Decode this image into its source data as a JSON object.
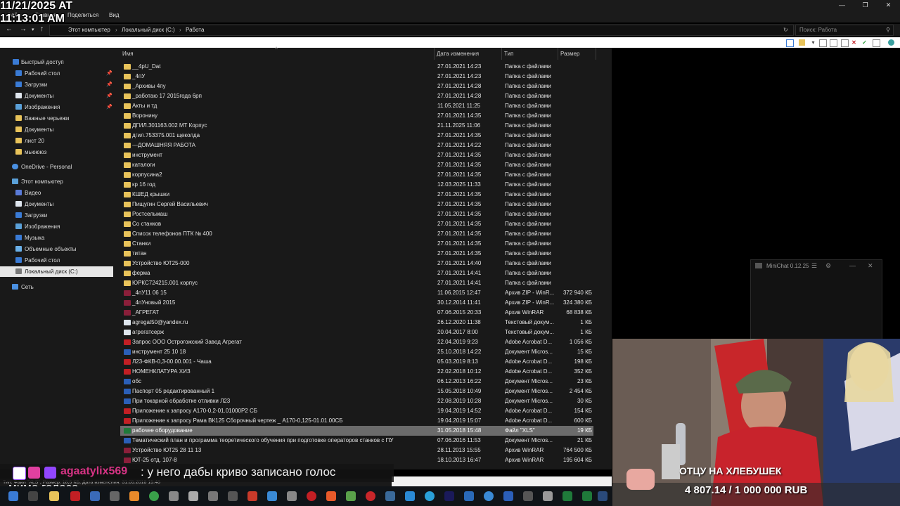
{
  "clock": {
    "line1": "11/21/2025 AT",
    "line2": "11:13:01 AM"
  },
  "ribbon": {
    "tabs": [
      "Файл",
      "Главная",
      "Поделиться",
      "Вид"
    ]
  },
  "address": {
    "crumbs": [
      "Этот компьютер",
      "Локальный диск (C:)",
      "Работа"
    ],
    "search_placeholder": "Поиск: Работа"
  },
  "nav": {
    "quick_access": "Быстрый доступ",
    "quick_items": [
      {
        "label": "Рабочий стол",
        "pinned": true
      },
      {
        "label": "Загрузки",
        "pinned": true
      },
      {
        "label": "Документы",
        "pinned": true
      },
      {
        "label": "Изображения",
        "pinned": true
      },
      {
        "label": "Важные черьежи",
        "pinned": false
      },
      {
        "label": "Документы",
        "pinned": false
      },
      {
        "label": "лист 20",
        "pinned": false
      },
      {
        "label": "мьюююз",
        "pinned": false
      }
    ],
    "onedrive": "OneDrive - Personal",
    "this_pc": "Этот компьютер",
    "pc_items": [
      "Видео",
      "Документы",
      "Загрузки",
      "Изображения",
      "Музыка",
      "Объемные объекты",
      "Рабочий стол",
      "Локальный диск (C:)"
    ],
    "network": "Сеть",
    "pin_glyph": "📌"
  },
  "columns": {
    "name": "Имя",
    "date": "Дата изменения",
    "type": "Тип",
    "size": "Размер"
  },
  "files": [
    {
      "name": "__4pU_Dat",
      "date": "27.01.2021 14:23",
      "type": "Папка с файлами",
      "size": "",
      "kind": "folder"
    },
    {
      "name": "_4пУ",
      "date": "27.01.2021 14:23",
      "type": "Папка с файлами",
      "size": "",
      "kind": "folder"
    },
    {
      "name": "_Архивы 4пу",
      "date": "27.01.2021 14:28",
      "type": "Папка с файлами",
      "size": "",
      "kind": "folder"
    },
    {
      "name": "_работаю 17 2015года 6рп",
      "date": "27.01.2021 14:28",
      "type": "Папка с файлами",
      "size": "",
      "kind": "folder"
    },
    {
      "name": "Акты и тд",
      "date": "11.05.2021 11:25",
      "type": "Папка с файлами",
      "size": "",
      "kind": "folder"
    },
    {
      "name": "Воронину",
      "date": "27.01.2021 14:35",
      "type": "Папка с файлами",
      "size": "",
      "kind": "folder"
    },
    {
      "name": "ДГИЛ.301163.002 МТ Корпус",
      "date": "21.11.2025 11:06",
      "type": "Папка с файлами",
      "size": "",
      "kind": "folder"
    },
    {
      "name": "дгил.753375.001 щеколда",
      "date": "27.01.2021 14:35",
      "type": "Папка с файлами",
      "size": "",
      "kind": "folder"
    },
    {
      "name": "---ДОМАШНЯЯ РАБОТА",
      "date": "27.01.2021 14:22",
      "type": "Папка с файлами",
      "size": "",
      "kind": "folder"
    },
    {
      "name": "инструмент",
      "date": "27.01.2021 14:35",
      "type": "Папка с файлами",
      "size": "",
      "kind": "folder"
    },
    {
      "name": "каталоги",
      "date": "27.01.2021 14:35",
      "type": "Папка с файлами",
      "size": "",
      "kind": "folder"
    },
    {
      "name": "корпусина2",
      "date": "27.01.2021 14:35",
      "type": "Папка с файлами",
      "size": "",
      "kind": "folder"
    },
    {
      "name": "кр 16 год",
      "date": "12.03.2025 11:33",
      "type": "Папка с файлами",
      "size": "",
      "kind": "folder"
    },
    {
      "name": "КШЕД крышки",
      "date": "27.01.2021 14:35",
      "type": "Папка с файлами",
      "size": "",
      "kind": "folder"
    },
    {
      "name": "Пищугин Сергей Васильевич",
      "date": "27.01.2021 14:35",
      "type": "Папка с файлами",
      "size": "",
      "kind": "folder"
    },
    {
      "name": "Ростсельмаш",
      "date": "27.01.2021 14:35",
      "type": "Папка с файлами",
      "size": "",
      "kind": "folder"
    },
    {
      "name": "Со станков",
      "date": "27.01.2021 14:35",
      "type": "Папка с файлами",
      "size": "",
      "kind": "folder"
    },
    {
      "name": "Список телефонов ПТК № 400",
      "date": "27.01.2021 14:35",
      "type": "Папка с файлами",
      "size": "",
      "kind": "folder"
    },
    {
      "name": "Станки",
      "date": "27.01.2021 14:35",
      "type": "Папка с файлами",
      "size": "",
      "kind": "folder"
    },
    {
      "name": "титан",
      "date": "27.01.2021 14:35",
      "type": "Папка с файлами",
      "size": "",
      "kind": "folder"
    },
    {
      "name": "Устройство ЮТ25-000",
      "date": "27.01.2021 14:40",
      "type": "Папка с файлами",
      "size": "",
      "kind": "folder"
    },
    {
      "name": "ферма",
      "date": "27.01.2021 14:41",
      "type": "Папка с файлами",
      "size": "",
      "kind": "folder"
    },
    {
      "name": "ЮРКС724215.001 корпус",
      "date": "27.01.2021 14:41",
      "type": "Папка с файлами",
      "size": "",
      "kind": "folder"
    },
    {
      "name": "_4пУ11 06 15",
      "date": "11.06.2015 12:47",
      "type": "Архив ZIP - WinR...",
      "size": "372 940 КБ",
      "kind": "zip"
    },
    {
      "name": "_4пУновый 2015",
      "date": "30.12.2014 11:41",
      "type": "Архив ZIP - WinR...",
      "size": "324 380 КБ",
      "kind": "zip"
    },
    {
      "name": "_АГРЕГАТ",
      "date": "07.06.2015 20:33",
      "type": "Архив WinRAR",
      "size": "68 838 КБ",
      "kind": "zip"
    },
    {
      "name": "agregat50@yandex.ru",
      "date": "26.12.2020 11:38",
      "type": "Текстовый докум...",
      "size": "1 КБ",
      "kind": "txt"
    },
    {
      "name": "агрегатсерж",
      "date": "20.04.2017 8:00",
      "type": "Текстовый докум...",
      "size": "1 КБ",
      "kind": "txt"
    },
    {
      "name": "Запрос ООО Острогожский Завод Агрегат",
      "date": "22.04.2019 9:23",
      "type": "Adobe Acrobat D...",
      "size": "1 056 КБ",
      "kind": "pdf"
    },
    {
      "name": "инструмент 25 10 18",
      "date": "25.10.2018 14:22",
      "type": "Документ Micros...",
      "size": "15 КБ",
      "kind": "doc"
    },
    {
      "name": "Л23-ФКВ-0,3-00.00.001 - Чаша",
      "date": "05.03.2019 8:13",
      "type": "Adobe Acrobat D...",
      "size": "198 КБ",
      "kind": "pdf"
    },
    {
      "name": "НОМЕНКЛАТУРА ХИЗ",
      "date": "22.02.2018 10:12",
      "type": "Adobe Acrobat D...",
      "size": "352 КБ",
      "kind": "pdf"
    },
    {
      "name": "обс",
      "date": "06.12.2013 16:22",
      "type": "Документ Micros...",
      "size": "23 КБ",
      "kind": "doc"
    },
    {
      "name": "Паспорт 05 редактированный 1",
      "date": "15.05.2018 10:49",
      "type": "Документ Micros...",
      "size": "2 454 КБ",
      "kind": "doc"
    },
    {
      "name": "При токарной обработке отливки Л23",
      "date": "22.08.2019 10:28",
      "type": "Документ Micros...",
      "size": "30 КБ",
      "kind": "doc"
    },
    {
      "name": "Приложение к запросу А170-0,2-01.01000Р2 СБ",
      "date": "19.04.2019 14:52",
      "type": "Adobe Acrobat D...",
      "size": "154 КБ",
      "kind": "pdf"
    },
    {
      "name": "Приложение к запросу Рама ВК125 Сборочный чертеж _ А170-0,125-01.01.00СБ",
      "date": "19.04.2019 15:07",
      "type": "Adobe Acrobat D...",
      "size": "600 КБ",
      "kind": "pdf"
    },
    {
      "name": "рабочее оборудование",
      "date": "31.05.2018 15:48",
      "type": "Файл \"XLS\"",
      "size": "19 КБ",
      "kind": "xls",
      "selected": true
    },
    {
      "name": "Тематический план и программа теоретического обучения при подготовке операторов станков с ПУ",
      "date": "07.06.2016 11:53",
      "type": "Документ Micros...",
      "size": "21 КБ",
      "kind": "doc"
    },
    {
      "name": "Устройство ЮТ25 28 11 13",
      "date": "28.11.2013 15:55",
      "type": "Архив WinRAR",
      "size": "764 500 КБ",
      "kind": "zip"
    },
    {
      "name": "ЮТ-25 отд. 107-8",
      "date": "18.10.2013 16:47",
      "type": "Архив WinRAR",
      "size": "195 604 КБ",
      "kind": "zip"
    }
  ],
  "status_bar": "Тип: Файл \"XLS\", Размер: 18,5 КБ, Дата изменения: 31.05.2018 15:48",
  "minichat": {
    "title": "MiniChat 0.12.25"
  },
  "chat": {
    "user": "agaatylix569",
    "message": ": у него дабы криво записано голос",
    "message2": "мимо голоса"
  },
  "overlay": {
    "goal_title": "ОТЦУ НА ХЛЕБУШЕК",
    "goal_amount": "4 807.14 / 1 000 000 RUB"
  },
  "window_buttons": [
    "—",
    "❐",
    "✕"
  ],
  "colors": {
    "folder": "#e8c35a",
    "selection": "#6b6b6b",
    "background": "#191919"
  }
}
